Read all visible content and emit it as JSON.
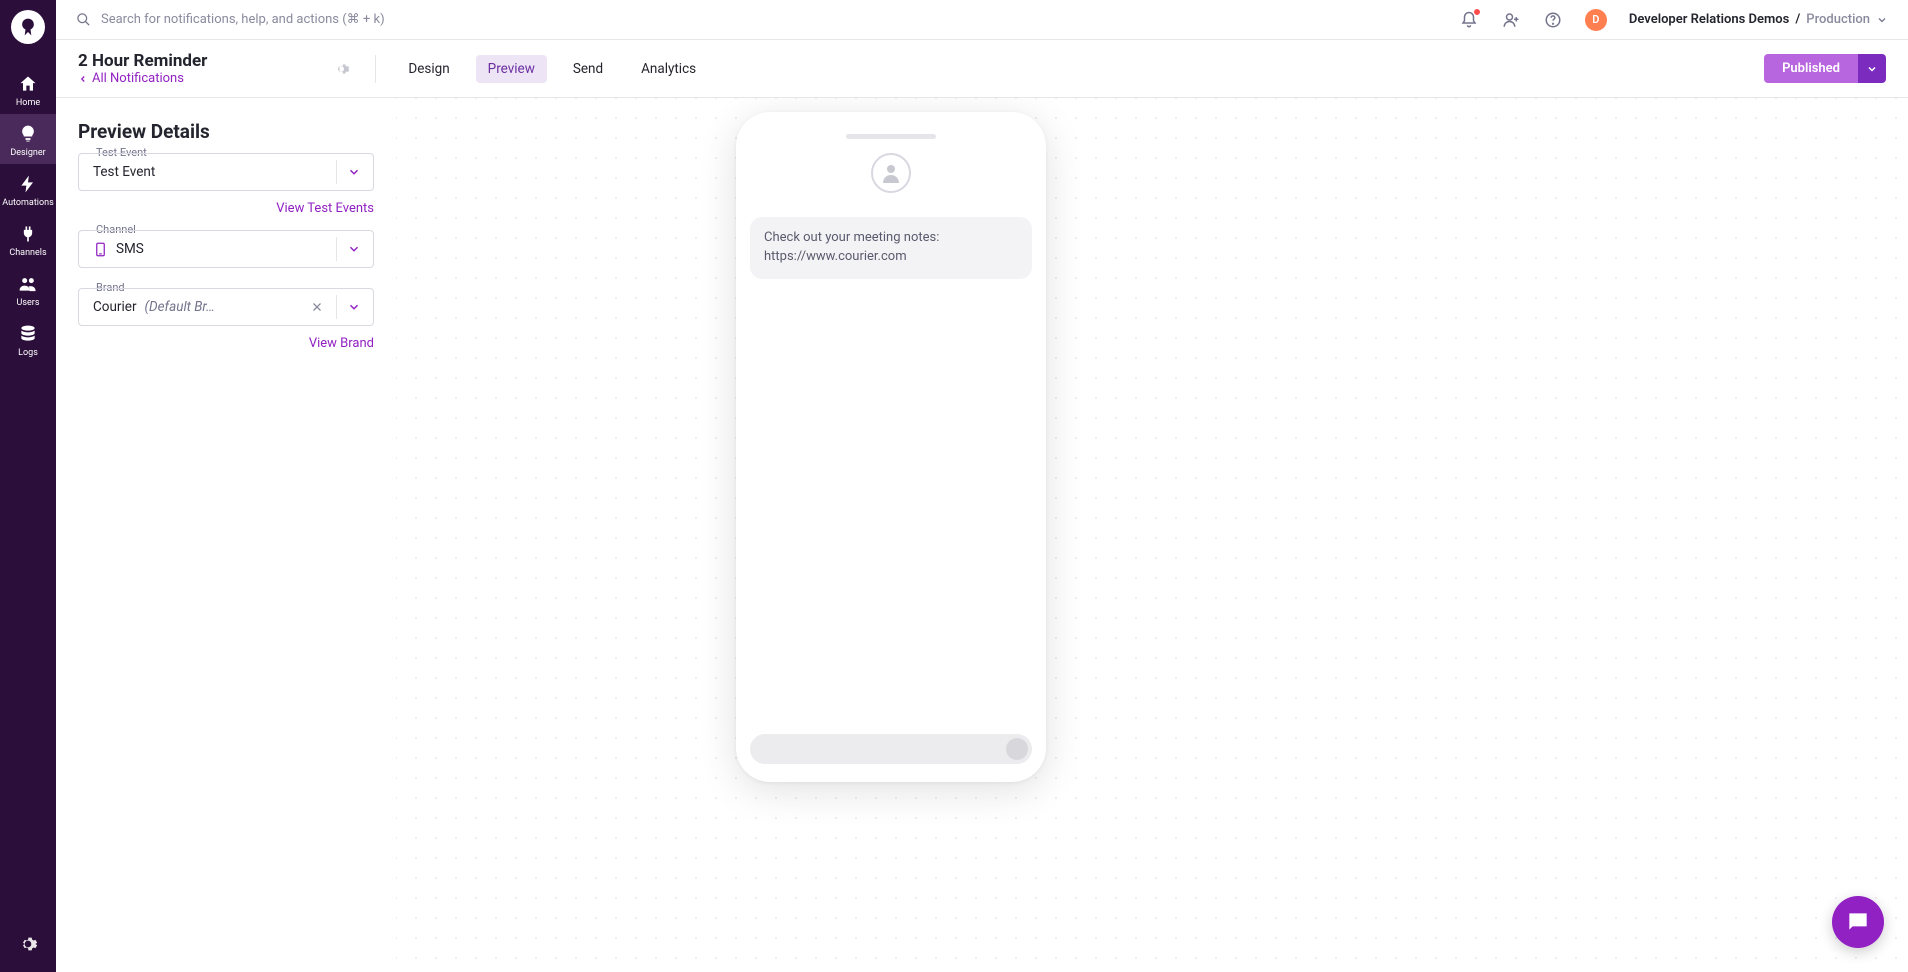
{
  "search": {
    "placeholder": "Search for notifications, help, and actions (⌘ + k)"
  },
  "sidebar": {
    "items": [
      {
        "label": "Home"
      },
      {
        "label": "Designer"
      },
      {
        "label": "Automations"
      },
      {
        "label": "Channels"
      },
      {
        "label": "Users"
      },
      {
        "label": "Logs"
      }
    ]
  },
  "top": {
    "avatar_initial": "D",
    "org": "Developer Relations Demos",
    "sep": " / ",
    "env": "Production"
  },
  "header": {
    "title": "2 Hour Reminder",
    "back_label": "All Notifications",
    "tabs": [
      "Design",
      "Preview",
      "Send",
      "Analytics"
    ],
    "active_tab": 1,
    "publish_label": "Published"
  },
  "preview": {
    "section_title": "Preview Details",
    "fields": {
      "test_event": {
        "label": "Test Event",
        "value": "Test Event",
        "view_link": "View Test Events"
      },
      "channel": {
        "label": "Channel",
        "value": "SMS"
      },
      "brand": {
        "label": "Brand",
        "value": "Courier ",
        "default": "(Default Br…",
        "view_link": "View Brand"
      }
    },
    "phone_message": "Check out your meeting notes:\nhttps://www.courier.com"
  }
}
